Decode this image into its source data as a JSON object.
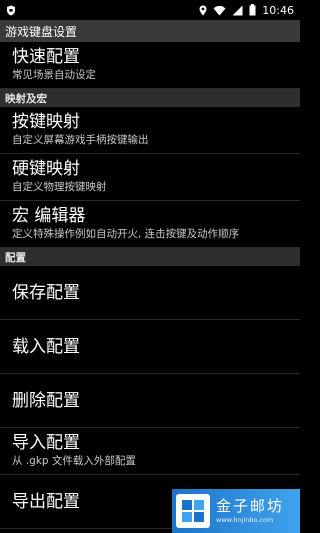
{
  "status_bar": {
    "time": "10:46",
    "icons": [
      "shield-icon",
      "location-icon",
      "wifi-icon",
      "signal-icon",
      "battery-icon"
    ]
  },
  "app_bar": {
    "title": "游戏键盘设置"
  },
  "sections": {
    "quick": {
      "title": "快速配置",
      "summary": "常见场景自动设定"
    },
    "mapping_category": "映射及宏",
    "key_mapping": {
      "title": "按键映射",
      "summary": "自定义屏幕游戏手柄按键输出"
    },
    "hard_key_mapping": {
      "title": "硬键映射",
      "summary": "自定义物理按键映射"
    },
    "macro_editor": {
      "title": "宏 编辑器",
      "summary": "定义特殊操作例如自动开火, 连击按键及动作顺序"
    },
    "config_category": "配置",
    "save": {
      "title": "保存配置"
    },
    "load": {
      "title": "载入配置"
    },
    "delete": {
      "title": "删除配置"
    },
    "import": {
      "title": "导入配置",
      "summary": "从 .gkp 文件载入外部配置"
    },
    "export": {
      "title": "导出配置"
    }
  },
  "watermark": {
    "title": "金子邮坊",
    "url": "www.hnjinbo.com",
    "colors": {
      "start": "#1d73c9",
      "end": "#3fa3ee"
    }
  }
}
